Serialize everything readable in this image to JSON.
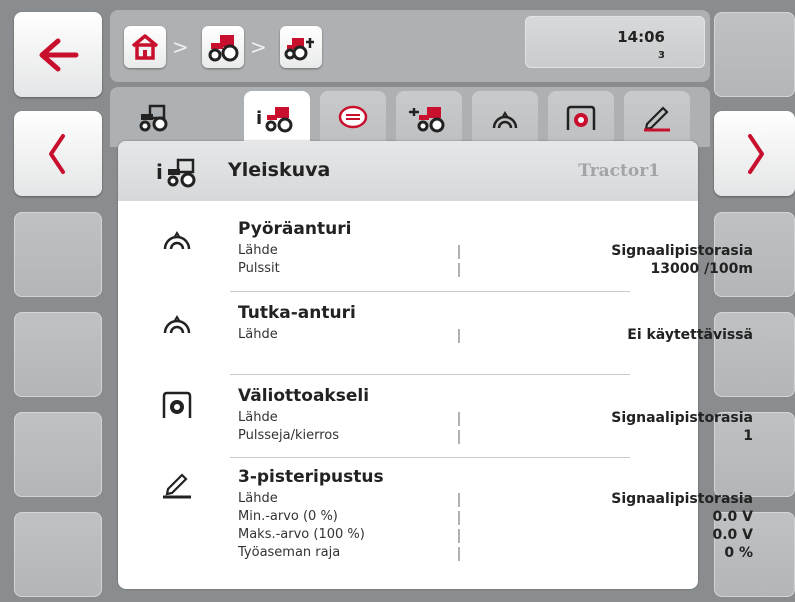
{
  "topbar": {
    "clock": {
      "time": "14:06",
      "number": "3"
    }
  },
  "icons": {
    "back": "arrow-left-icon",
    "prev": "chevron-left-icon",
    "next": "chevron-right-icon",
    "home": "home-icon",
    "tractor": "tractor-icon",
    "implement": "implement-tractor-icon"
  },
  "colors": {
    "accent": "#c8102e",
    "headerText": "#a2a4a6"
  },
  "panel": {
    "title": "Yleiskuva",
    "tractor_name": "Tractor1"
  },
  "sections": [
    {
      "title": "Pyöräanturi",
      "icon": "wheel-sensor-icon",
      "rows": [
        {
          "label": "Lähde",
          "value": "Signaalipistorasia"
        },
        {
          "label": "Pulssit",
          "value": "13000 /100m"
        }
      ]
    },
    {
      "title": "Tutka-anturi",
      "icon": "radar-sensor-icon",
      "rows": [
        {
          "label": "Lähde",
          "value": "Ei käytettävissä"
        }
      ]
    },
    {
      "title": "Väliottoakseli",
      "icon": "pto-icon",
      "rows": [
        {
          "label": "Lähde",
          "value": "Signaalipistorasia"
        },
        {
          "label": "Pulsseja/kierros",
          "value": "1"
        }
      ]
    },
    {
      "title": "3-pisteripustus",
      "icon": "three-point-hitch-icon",
      "rows": [
        {
          "label": "Lähde",
          "value": "Signaalipistorasia"
        },
        {
          "label": "Min.-arvo (0 %)",
          "value": "0.0 V"
        },
        {
          "label": "Maks.-arvo (100 %)",
          "value": "0.0 V"
        },
        {
          "label": "Työaseman raja",
          "value": "0 %"
        }
      ]
    }
  ]
}
